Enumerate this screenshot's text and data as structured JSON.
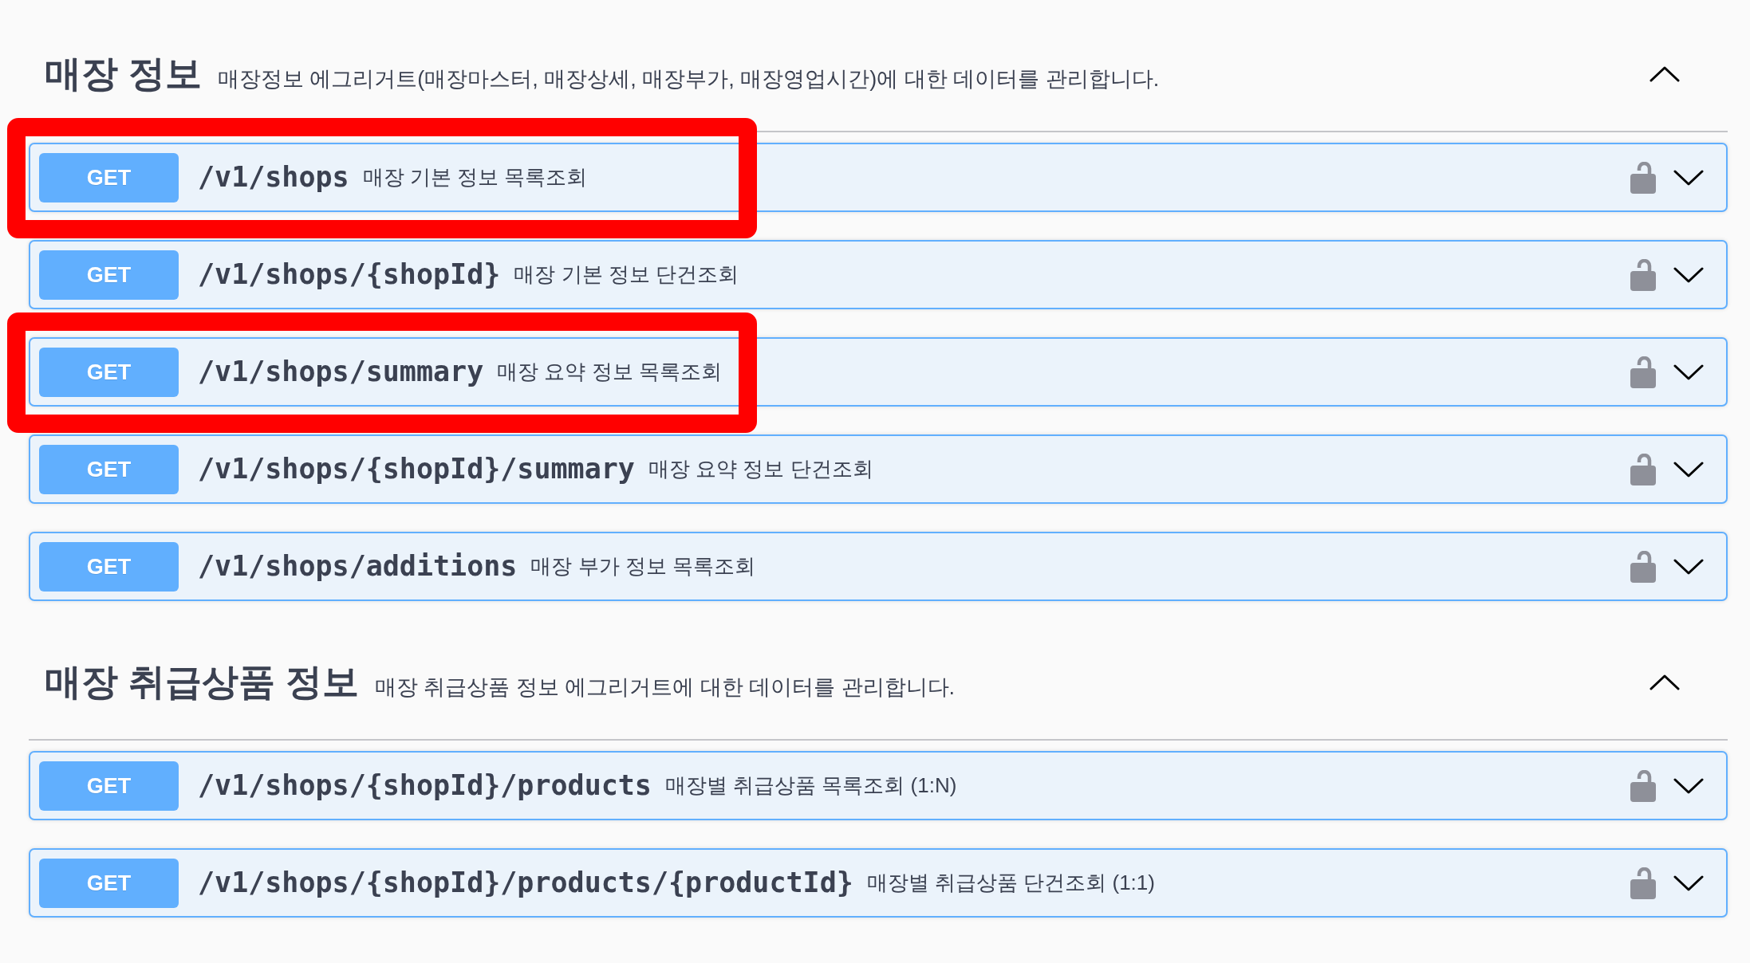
{
  "sections": [
    {
      "title": "매장 정보",
      "description": "매장정보 에그리거트(매장마스터, 매장상세, 매장부가, 매장영업시간)에 대한 데이터를 관리합니다.",
      "expanded": true,
      "operations": [
        {
          "method": "GET",
          "path": "/v1/shops",
          "summary": "매장 기본 정보 목록조회",
          "locked": false,
          "expanded": false,
          "highlighted": true
        },
        {
          "method": "GET",
          "path": "/v1/shops/{shopId}",
          "summary": "매장 기본 정보 단건조회",
          "locked": false,
          "expanded": false,
          "highlighted": false
        },
        {
          "method": "GET",
          "path": "/v1/shops/summary",
          "summary": "매장 요약 정보 목록조회",
          "locked": false,
          "expanded": false,
          "highlighted": true
        },
        {
          "method": "GET",
          "path": "/v1/shops/{shopId}/summary",
          "summary": "매장 요약 정보 단건조회",
          "locked": false,
          "expanded": false,
          "highlighted": false
        },
        {
          "method": "GET",
          "path": "/v1/shops/additions",
          "summary": "매장 부가 정보 목록조회",
          "locked": false,
          "expanded": false,
          "highlighted": false
        }
      ]
    },
    {
      "title": "매장 취급상품 정보",
      "description": "매장 취급상품 정보 에그리거트에 대한 데이터를 관리합니다.",
      "expanded": true,
      "operations": [
        {
          "method": "GET",
          "path": "/v1/shops/{shopId}/products",
          "summary": "매장별 취급상품 목록조회 (1:N)",
          "locked": false,
          "expanded": false,
          "highlighted": false
        },
        {
          "method": "GET",
          "path": "/v1/shops/{shopId}/products/{productId}",
          "summary": "매장별 취급상품 단건조회 (1:1)",
          "locked": false,
          "expanded": false,
          "highlighted": false
        }
      ]
    }
  ]
}
